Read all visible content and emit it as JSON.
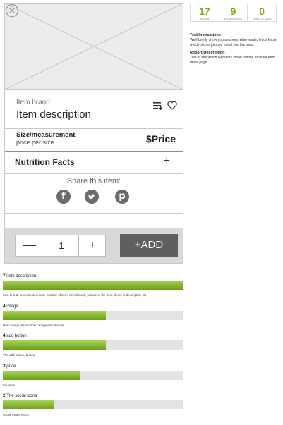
{
  "mockup": {
    "item_brand": "Item brand",
    "item_description": "Item description",
    "size_title": "Size/measurement",
    "size_subtitle": "price per size",
    "price": "$Price",
    "nutrition_label": "Nutrition Facts",
    "nutrition_toggle": "+",
    "share_label": "Share this item:",
    "social": [
      {
        "icon": "facebook-icon",
        "glyph": "f"
      },
      {
        "icon": "twitter-icon",
        "glyph": "t"
      },
      {
        "icon": "pinterest-icon",
        "glyph": "p"
      }
    ],
    "stepper": {
      "minus": "—",
      "quantity": "1",
      "plus": "+"
    },
    "add_button": "+ADD"
  },
  "stats": [
    {
      "value": "17",
      "label": "VIEWS"
    },
    {
      "value": "9",
      "label": "RESPONSES"
    },
    {
      "value": "0",
      "label": "TESTER DATA"
    }
  ],
  "panel": {
    "instructions_title": "Test Instructions",
    "instructions_text": "We'll briefly show you a screen. Afterwards, let us know which pieces jumped out at you the most.",
    "report_title": "Report Description",
    "report_text": "Test to see which elements stood out the most for item detail page"
  },
  "results_max": 7,
  "results": [
    {
      "count": "7",
      "label": "item description",
      "note": "item brand, increase/decrease number of item, Item brand , picture of the item, items in description list",
      "value": 7
    },
    {
      "count": "4",
      "label": "image",
      "note": "Hero image placeholder, image placeholder",
      "value": 4
    },
    {
      "count": "4",
      "label": "add button",
      "note": "The add button, button",
      "value": 4
    },
    {
      "count": "3",
      "label": "price",
      "note": "the price",
      "value": 3
    },
    {
      "count": "2",
      "label": "The social icons",
      "note": "social media icons",
      "value": 2
    }
  ],
  "colors": {
    "accent_green": "#7aae0e",
    "button_dark": "#5f5f5f"
  }
}
